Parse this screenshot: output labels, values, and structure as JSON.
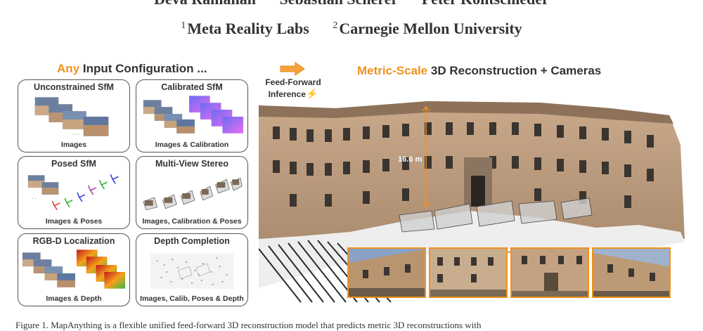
{
  "authors": [
    "Deva Ramanan",
    "Sebastian Scherer",
    "Peter Kontschieder"
  ],
  "affiliations": [
    {
      "num": "1",
      "name": "Meta Reality Labs"
    },
    {
      "num": "2",
      "name": "Carnegie Mellon University"
    }
  ],
  "left_heading": {
    "accent": "Any",
    "rest": " Input Configuration ..."
  },
  "arrow_label": {
    "line1": "Feed-Forward",
    "line2": "Inference"
  },
  "right_heading": {
    "accent": "Metric-Scale",
    "rest": " 3D Reconstruction + Cameras"
  },
  "panels": [
    {
      "title": "Unconstrained SfM",
      "caption": "Images"
    },
    {
      "title": "Calibrated SfM",
      "caption": "Images & Calibration"
    },
    {
      "title": "Posed SfM",
      "caption": "Images & Poses"
    },
    {
      "title": "Multi-View Stereo",
      "caption": "Images, Calibration & Poses"
    },
    {
      "title": "RGB-D Localization",
      "caption": "Images & Depth"
    },
    {
      "title": "Depth Completion",
      "caption": "Images, Calib, Poses & Depth"
    }
  ],
  "measure_label": "16.6 m",
  "caption_text": "Figure 1. MapAnything is a flexible unified feed-forward 3D reconstruction model that predicts metric 3D reconstructions with",
  "colors": {
    "accent": "#f0921e",
    "border": "#555555"
  },
  "icons": {
    "arrow": "orange-right-arrow-icon",
    "bolt": "lightning-bolt-icon"
  }
}
